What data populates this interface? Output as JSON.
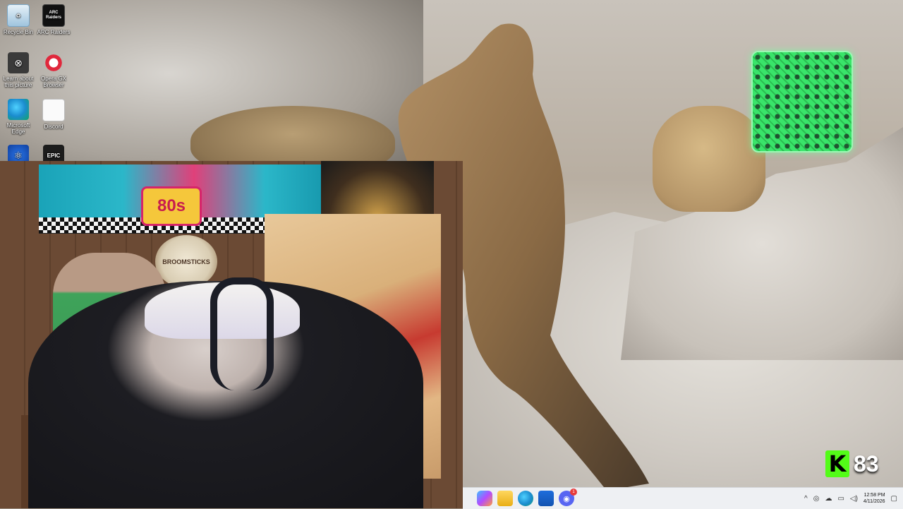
{
  "desktop": {
    "icons": [
      {
        "label": "Recycle Bin",
        "glyph": "♻"
      },
      {
        "label": "ARC Raiders",
        "glyph": "ARC\nRaiders"
      },
      {
        "label": "Learn about this picture",
        "glyph": "⊗"
      },
      {
        "label": "Opera GX Browser",
        "glyph": ""
      },
      {
        "label": "Microsoft Edge",
        "glyph": ""
      },
      {
        "label": "Discord",
        "glyph": ""
      },
      {
        "label": "",
        "glyph": "⚛"
      },
      {
        "label": "",
        "glyph": "EPIC"
      }
    ]
  },
  "webcam": {
    "banner_text": "80s",
    "sign_text": "BROOMSTICKS"
  },
  "kick": {
    "logo_letter": "K",
    "viewer_count": "83",
    "brand_color": "#53fc18"
  },
  "taskbar": {
    "apps": [
      {
        "name": "copilot-icon"
      },
      {
        "name": "file-explorer-icon"
      },
      {
        "name": "edge-icon"
      },
      {
        "name": "store-icon"
      },
      {
        "name": "discord-icon",
        "badge": "1"
      }
    ],
    "tray": {
      "chevron": "^",
      "time": "12:58 PM",
      "date": "4/11/2026"
    }
  }
}
